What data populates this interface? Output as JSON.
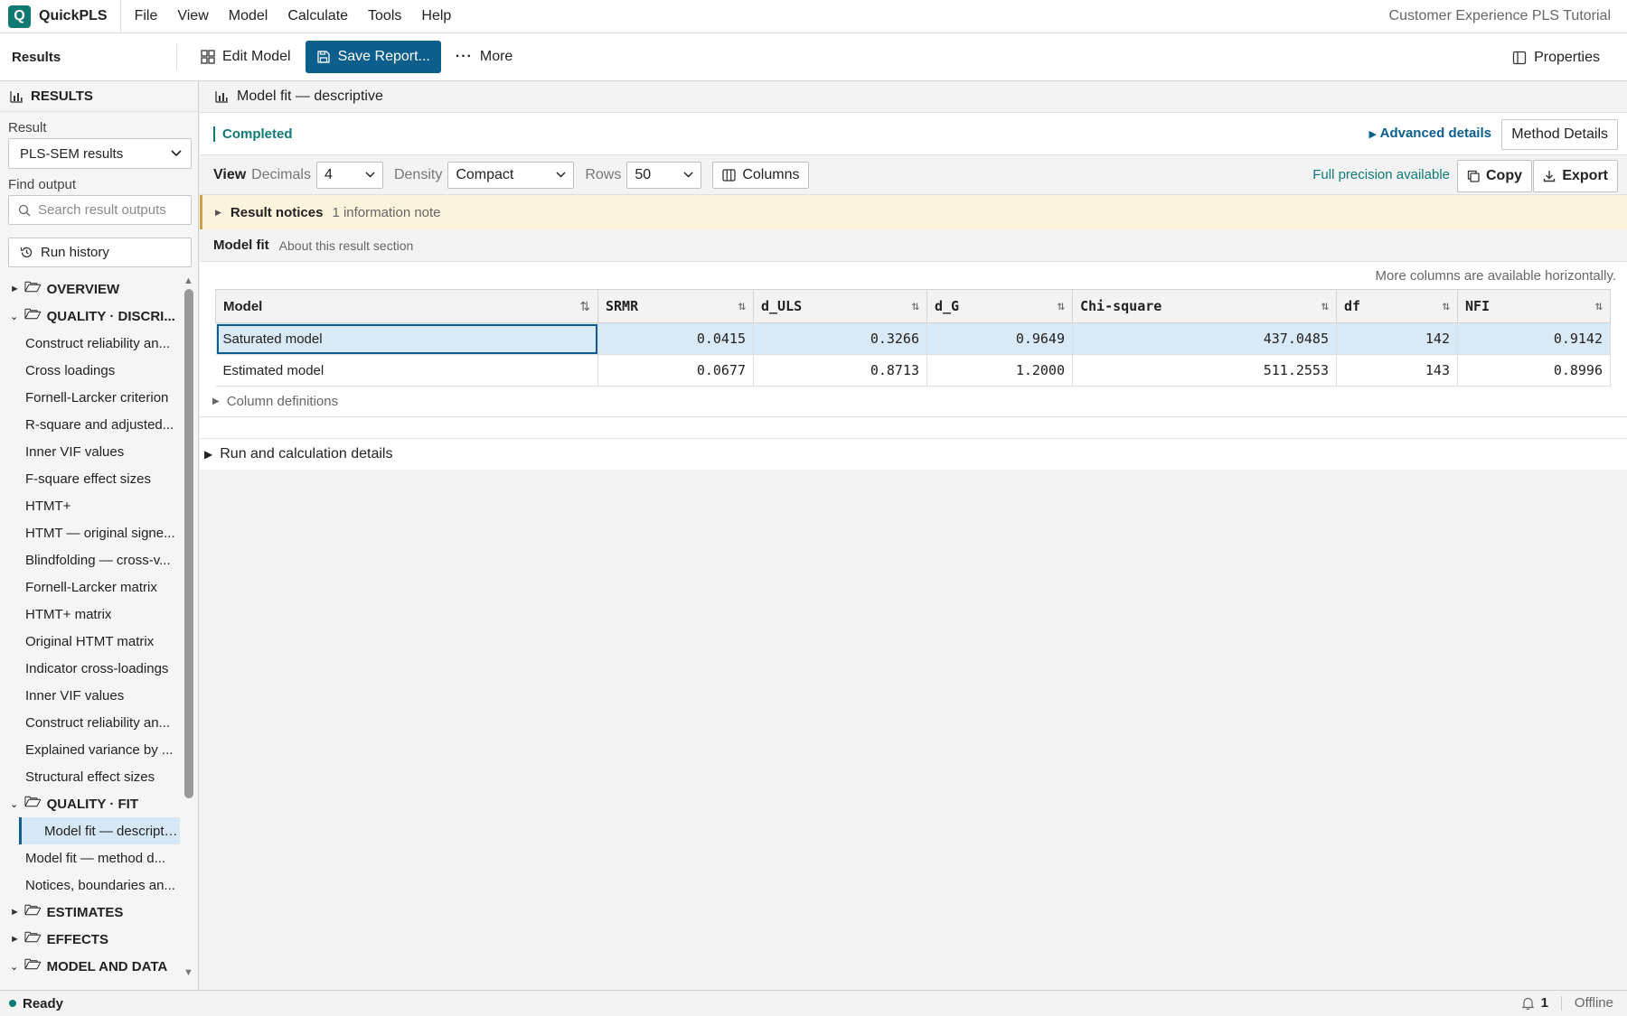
{
  "app": {
    "logo_letter": "Q",
    "name": "QuickPLS",
    "document_title": "Customer Experience PLS Tutorial"
  },
  "menu": [
    "File",
    "View",
    "Model",
    "Calculate",
    "Tools",
    "Help"
  ],
  "toolbar": {
    "title": "Results",
    "edit_model": "Edit Model",
    "save_report": "Save Report...",
    "more": "More",
    "properties": "Properties"
  },
  "left_panel": {
    "header": "RESULTS",
    "result_label": "Result",
    "result_value": "PLS-SEM results",
    "find_label": "Find output",
    "search_placeholder": "Search result outputs",
    "run_history": "Run history",
    "groups": {
      "overview": "OVERVIEW",
      "quality_discri": "QUALITY · DISCRI...",
      "quality_fit": "QUALITY · FIT",
      "estimates": "ESTIMATES",
      "effects": "EFFECTS",
      "model_and_data": "MODEL AND DATA"
    },
    "discri_items": [
      "Construct reliability an...",
      "Cross loadings",
      "Fornell-Larcker criterion",
      "R-square and adjusted...",
      "Inner VIF values",
      "F-square effect sizes",
      "HTMT+",
      "HTMT — original signe...",
      "Blindfolding — cross-v...",
      "Fornell-Larcker matrix",
      "HTMT+ matrix",
      "Original HTMT matrix",
      "Indicator cross-loadings",
      "Inner VIF values",
      "Construct reliability an...",
      "Explained variance by ...",
      "Structural effect sizes"
    ],
    "fit_items": [
      "Model fit — descriptive",
      "Model fit — method d...",
      "Notices, boundaries an..."
    ]
  },
  "main": {
    "header_title": "Model fit — descriptive",
    "status": "Completed",
    "advanced_details": "Advanced details",
    "method_details": "Method Details",
    "view_label": "View",
    "decimals_label": "Decimals",
    "decimals_value": "4",
    "density_label": "Density",
    "density_value": "Compact",
    "rows_label": "Rows",
    "rows_value": "50",
    "columns_btn": "Columns",
    "precision_text": "Full precision available",
    "copy": "Copy",
    "export": "Export",
    "notices_title": "Result notices",
    "notices_sub": "1 information note",
    "section_title": "Model fit",
    "section_sub": "About this result section",
    "more_columns": "More columns are available horizontally.",
    "column_definitions": "Column definitions",
    "run_details": "Run and calculation details"
  },
  "table": {
    "columns": [
      "Model",
      "SRMR",
      "d_ULS",
      "d_G",
      "Chi-square",
      "df",
      "NFI"
    ],
    "rows": [
      [
        "Saturated model",
        "0.0415",
        "0.3266",
        "0.9649",
        "437.0485",
        "142",
        "0.9142"
      ],
      [
        "Estimated model",
        "0.0677",
        "0.8713",
        "1.2000",
        "511.2553",
        "143",
        "0.8996"
      ]
    ]
  },
  "statusbar": {
    "ready": "Ready",
    "notifications": "1",
    "connection": "Offline"
  },
  "colors": {
    "accent_teal": "#0f7a74",
    "primary_blue": "#0c5e8d",
    "selection": "#d9e9f6",
    "notice_bg": "#fbf3dc"
  }
}
